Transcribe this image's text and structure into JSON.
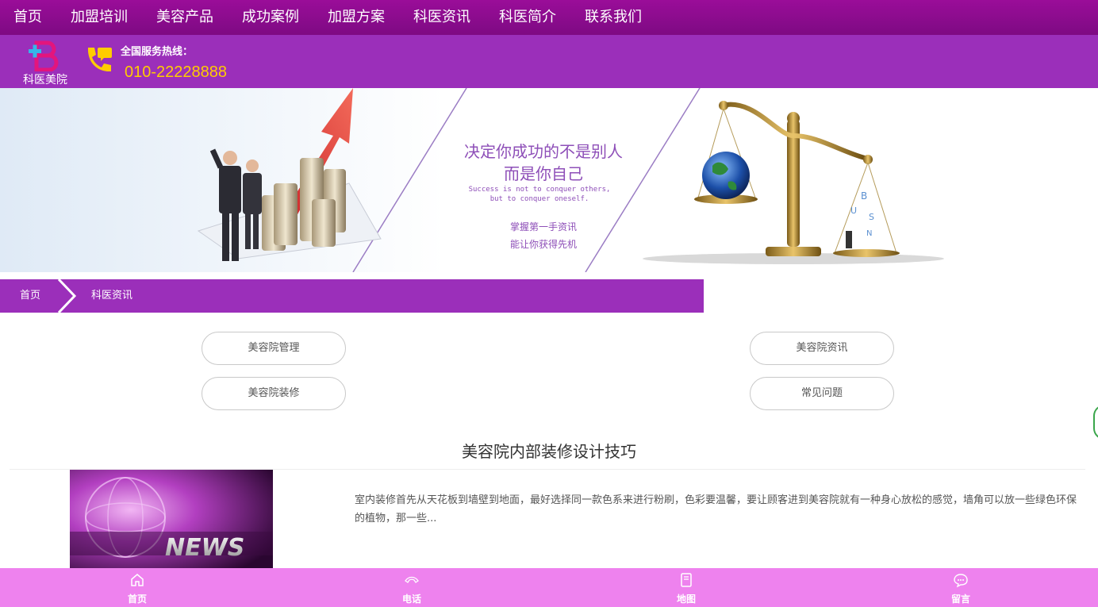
{
  "nav": {
    "items": [
      {
        "label": "首页"
      },
      {
        "label": "加盟培训"
      },
      {
        "label": "美容产品"
      },
      {
        "label": "成功案例"
      },
      {
        "label": "加盟方案"
      },
      {
        "label": "科医资讯"
      },
      {
        "label": "科医简介"
      },
      {
        "label": "联系我们"
      }
    ]
  },
  "header": {
    "logo_text": "科医美院",
    "hotline_label": "全国服务热线：",
    "hotline_number": "010-22228888"
  },
  "banner": {
    "headline_line1": "决定你成功的不是别人",
    "headline_line2": "而是你自己",
    "english_line1": "Success is not to conquer others,",
    "english_line2": "but to conquer oneself.",
    "sub_line1": "掌握第一手资讯",
    "sub_line2": "能让你获得先机",
    "accent_color": "#8e4fb8"
  },
  "breadcrumb": {
    "home": "首页",
    "current": "科医资讯"
  },
  "categories": [
    {
      "label": "美容院管理"
    },
    {
      "label": "美容院资讯"
    },
    {
      "label": "美容院装修"
    },
    {
      "label": "常见问题"
    }
  ],
  "article": {
    "title": "美容院内部装修设计技巧",
    "excerpt": "室内装修首先从天花板到墙壁到地面，最好选择同一款色系来进行粉刷，色彩要温馨，要让顾客进到美容院就有一种身心放松的感觉，墙角可以放一些绿色环保的植物，那一些...",
    "thumb_text": "NEWS"
  },
  "bottom_bar": {
    "items": [
      {
        "label": "首页",
        "icon": "home-icon"
      },
      {
        "label": "电话",
        "icon": "phone-icon"
      },
      {
        "label": "地图",
        "icon": "map-icon"
      },
      {
        "label": "留言",
        "icon": "message-icon"
      }
    ]
  },
  "colors": {
    "nav_bg": "#8a0b8c",
    "header_bg": "#9b2fba",
    "hotline_color": "#ffcc00",
    "bottom_bar_bg": "#ee82ee"
  }
}
